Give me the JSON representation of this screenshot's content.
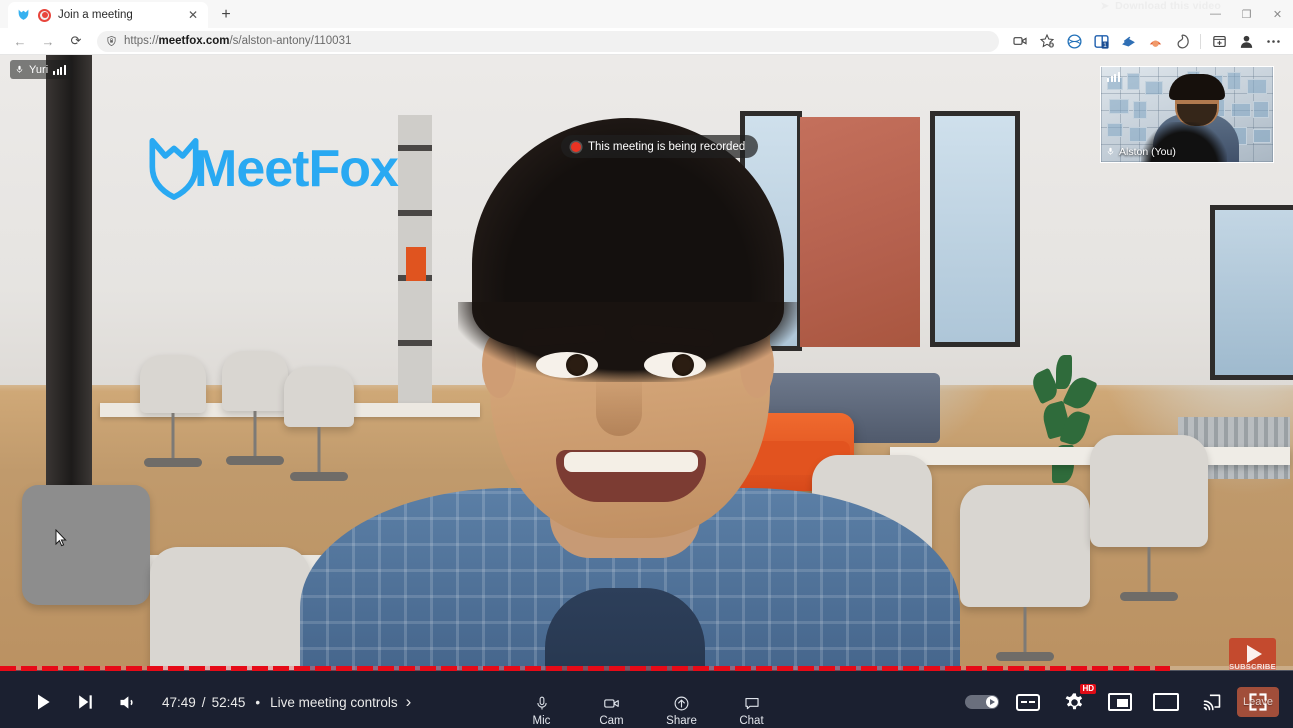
{
  "browser": {
    "tab": {
      "title": "Join a meeting",
      "favicon_icon": "meetfox-fox-icon",
      "recording_indicator_icon": "tab-recording-dot-icon",
      "close_label": "✕"
    },
    "new_tab_label": "+",
    "window_controls": {
      "minimize": "—",
      "maximize": "❐",
      "close": "✕"
    },
    "ghost_overlay_text": "Download this video",
    "nav": {
      "back": "←",
      "forward": "→",
      "reload": "⟳"
    },
    "url": {
      "scheme": "https://",
      "domain": "meetfox.com",
      "path": "/s/alston-antony/110031",
      "lock_icon": "shield-lock-icon"
    },
    "toolbar_icons": [
      "screen-capture-icon",
      "favorites-star-add-icon",
      "browser-essentials-icon",
      "split-screen-icon",
      "immersive-reader-icon",
      "collections-icon",
      "copilot-icon",
      "add-vertical-tab-icon",
      "profile-avatar-icon",
      "settings-more-icon"
    ]
  },
  "stage": {
    "remote_participant": {
      "name": "Yuri",
      "mic_icon": "microphone-icon",
      "signal_icon": "signal-bars-icon"
    },
    "recording_notice": {
      "text": "This meeting is being recorded",
      "dot_icon": "recording-dot-icon"
    },
    "brand_logo": {
      "text": "MeetFox",
      "color": "#29a9f2"
    },
    "self_view": {
      "name": "Alston (You)",
      "mic_icon": "microphone-icon",
      "signal_icon": "signal-bars-icon"
    },
    "subscribe_watermark": {
      "label": "SUBSCRIBE",
      "icon": "youtube-play-icon",
      "color": "#c53e25"
    },
    "cursor_icon": "mouse-pointer-icon"
  },
  "player": {
    "progress_percent": 90.5,
    "play_icon": "play-icon",
    "next_icon": "next-track-icon",
    "volume_icon": "volume-icon",
    "time_current": "47:49",
    "time_separator": "/",
    "time_total": "52:45",
    "bullet": "•",
    "chapter_label": "Live meeting controls",
    "chapter_chevron": "›",
    "meeting_controls": [
      {
        "label": "Mic",
        "icon": "microphone-icon"
      },
      {
        "label": "Cam",
        "icon": "camera-icon"
      },
      {
        "label": "Share",
        "icon": "share-up-arrow-icon"
      },
      {
        "label": "Chat",
        "icon": "chat-bubble-icon"
      }
    ],
    "right_controls": {
      "autoplay_icon": "autoplay-toggle-icon",
      "captions_icon": "closed-captions-icon",
      "settings_icon": "settings-gear-icon",
      "quality_badge": "HD",
      "miniplayer_icon": "miniplayer-icon",
      "theater_icon": "theater-mode-icon",
      "cast_icon": "cast-icon",
      "leave_label": "Leave",
      "fullscreen_icon": "fullscreen-icon"
    }
  }
}
